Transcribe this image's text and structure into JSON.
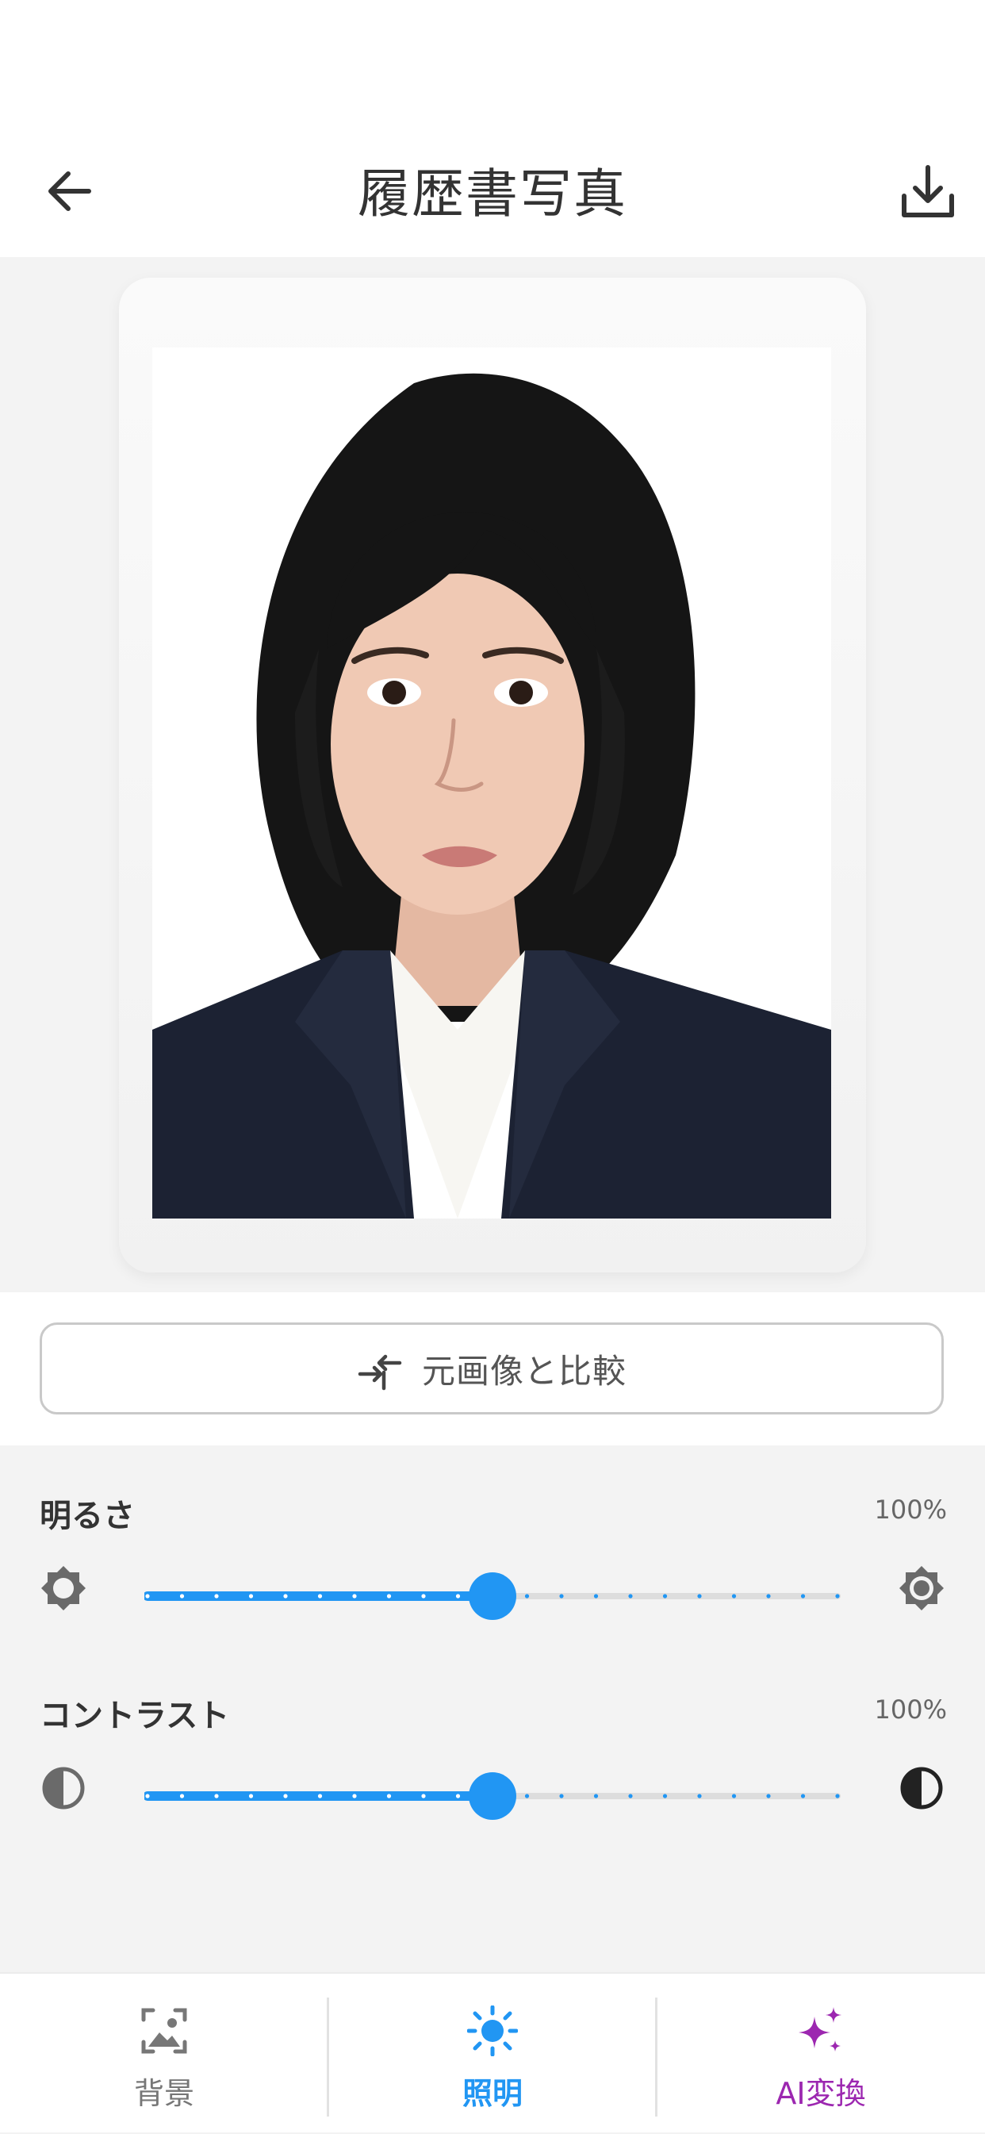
{
  "header": {
    "title": "履歴書写真",
    "back_icon": "arrow-left-icon",
    "download_icon": "download-icon"
  },
  "compare_button": {
    "label": "元画像と比較",
    "icon": "swap-arrows-icon"
  },
  "adjustments": [
    {
      "label": "明るさ",
      "value_text": "100%",
      "level": 0.5,
      "left_icon": "brightness-low-icon",
      "right_icon": "brightness-high-icon"
    },
    {
      "label": "コントラスト",
      "value_text": "100%",
      "level": 0.5,
      "left_icon": "contrast-low-icon",
      "right_icon": "contrast-high-icon"
    }
  ],
  "bottom_nav": {
    "items": [
      {
        "label": "背景",
        "icon": "background-image-icon",
        "active": false
      },
      {
        "label": "照明",
        "icon": "sun-icon",
        "active": true
      },
      {
        "label": "AI変換",
        "icon": "sparkle-icon",
        "active": false
      }
    ]
  },
  "colors": {
    "accent": "#2196f3",
    "ai_purple": "#9c27b0",
    "inactive": "#777777",
    "track": "#dddddd"
  }
}
